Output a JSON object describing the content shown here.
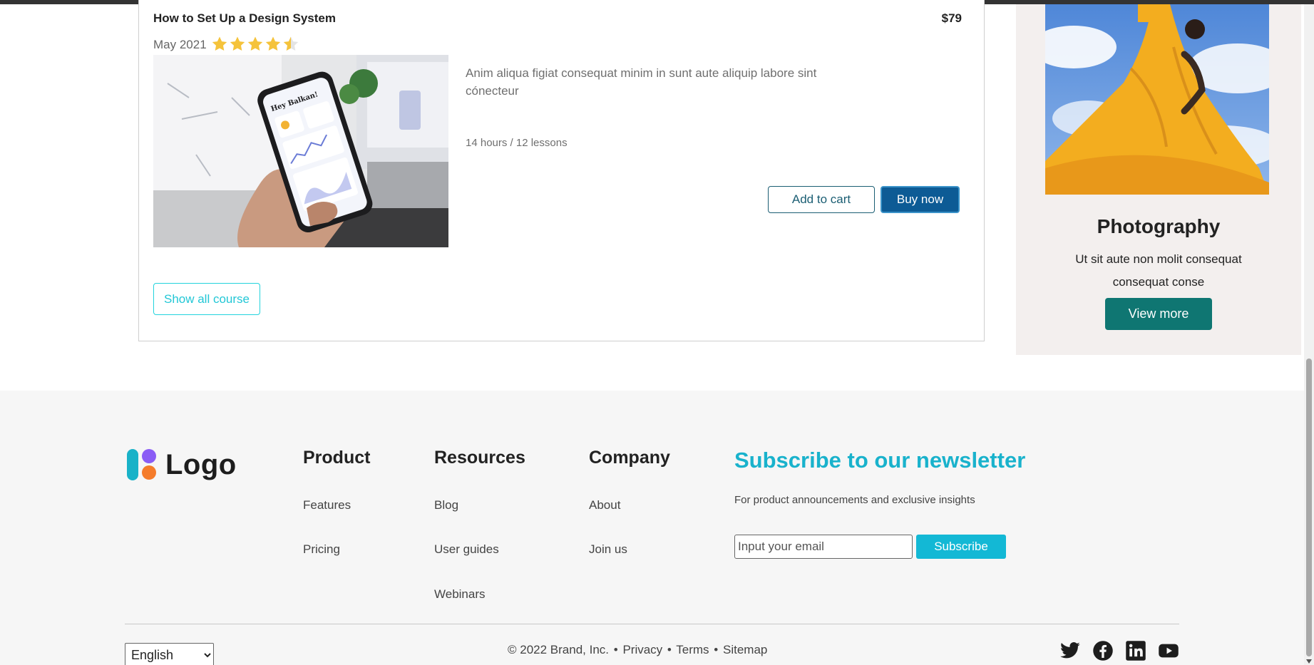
{
  "course": {
    "title": "How to Set Up a Design System",
    "price": "$79",
    "date": "May 2021",
    "rating": 4.5,
    "rating_max": 5,
    "description": "Anim aliqua figiat consequat minim in sunt aute aliquip labore sint cónecteur",
    "meta": "14 hours / 12 lessons",
    "add_to_cart_label": "Add to cart",
    "buy_now_label": "Buy now",
    "show_all_label": "Show all course"
  },
  "side_card": {
    "title": "Photography",
    "text": "Ut sit aute non molit consequat consequat conse",
    "button_label": "View more"
  },
  "footer": {
    "logo_text": "Logo",
    "columns": [
      {
        "heading": "Product",
        "links": [
          "Features",
          "Pricing"
        ]
      },
      {
        "heading": "Resources",
        "links": [
          "Blog",
          "User guides",
          "Webinars"
        ]
      },
      {
        "heading": "Company",
        "links": [
          "About",
          "Join us"
        ]
      }
    ],
    "newsletter": {
      "heading": "Subscribe to our newsletter",
      "subtext": "For product announcements and exclusive insights",
      "email_placeholder": "Input your email",
      "button_label": "Subscribe"
    },
    "language": {
      "selected": "English"
    },
    "copyright": "© 2022 Brand, Inc.",
    "legal_links": [
      "Privacy",
      "Terms",
      "Sitemap"
    ],
    "separator": "•",
    "social": [
      "twitter-icon",
      "facebook-icon",
      "linkedin-icon",
      "youtube-icon"
    ]
  },
  "colors": {
    "primary_button": "#0d5b95",
    "teal_button": "#0f7672",
    "accent_cyan": "#19b2cc",
    "star": "#f5c33b"
  }
}
